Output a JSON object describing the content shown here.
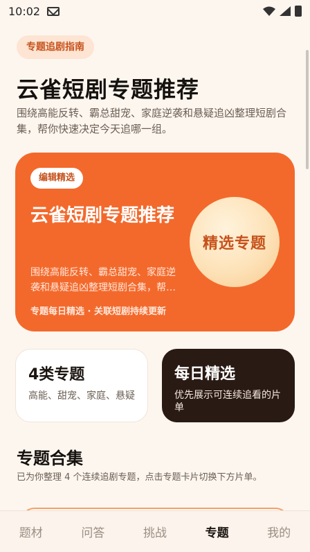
{
  "status_bar": {
    "time": "10:02"
  },
  "header": {
    "chip": "专题追剧指南",
    "title": "云雀短剧专题推荐",
    "description": "围绕高能反转、霸总甜宠、家庭逆袭和悬疑追凶整理短剧合集，帮你快速决定今天追哪一组。"
  },
  "hero": {
    "badge": "编辑精选",
    "title": "云雀短剧专题推荐",
    "description": "围绕高能反转、霸总甜宠、家庭逆袭和悬疑追凶整理短剧合集，帮你快速决定今天追哪一组。",
    "footer": "专题每日精选 · 关联短剧持续更新",
    "circle_label": "精选专题",
    "color": "#f3692c"
  },
  "stats": [
    {
      "title": "4类专题",
      "subtitle": "高能、甜宠、家庭、悬疑"
    },
    {
      "title": "每日精选",
      "subtitle": "优先展示可连续追看的片单"
    }
  ],
  "section": {
    "title": "专题合集",
    "description": "已为你整理 4 个连续追剧专题，点击专题卡片切换下方片单。"
  },
  "nav": {
    "items": [
      {
        "label": "题材"
      },
      {
        "label": "问答"
      },
      {
        "label": "挑战"
      },
      {
        "label": "专题"
      },
      {
        "label": "我的"
      }
    ],
    "active": "专题"
  }
}
